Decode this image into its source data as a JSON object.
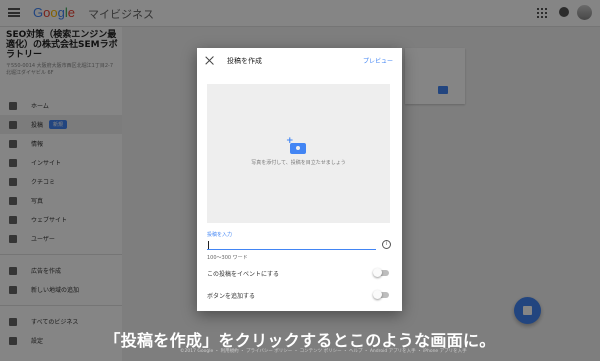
{
  "header": {
    "brand": "Google",
    "product": "マイビジネス"
  },
  "sidebar": {
    "business_name": "SEO対策（検索エンジン最適化）の株式会社SEMラボラトリー",
    "address": "〒550-0014 大阪府大阪市西区北堀江1丁目2-7 北堀江ダイヤビル 6F",
    "items": [
      {
        "label": "ホーム"
      },
      {
        "label": "投稿",
        "badge": "新規"
      },
      {
        "label": "情報"
      },
      {
        "label": "インサイト"
      },
      {
        "label": "クチコミ"
      },
      {
        "label": "写真"
      },
      {
        "label": "ウェブサイト"
      },
      {
        "label": "ユーザー"
      },
      {
        "label": "広告を作成"
      },
      {
        "label": "新しい地域の追加"
      },
      {
        "label": "すべてのビジネス"
      },
      {
        "label": "設定"
      }
    ]
  },
  "dialog": {
    "title": "投稿を作成",
    "preview": "プレビュー",
    "photo_hint": "写真を添付して、投稿を目立たせましょう",
    "post_label": "投稿を入力",
    "post_value": "",
    "info_icon": "i",
    "word_count": "100〜300 ワード",
    "event_toggle": "この投稿をイベントにする",
    "button_toggle": "ボタンを追加する"
  },
  "footer": {
    "text": "©2017 Google ・ 利用規約 ・ プライバシー ポリシー ・ コンテンツ ポリシー ・ ヘルプ ・ Android アプリを入手 ・ iPhone アプリを入手"
  },
  "caption": "「投稿を作成」をクリックするとこのような画面に。",
  "colors": {
    "accent": "#4285f4",
    "scrim": "rgba(0,0,0,0.48)"
  }
}
